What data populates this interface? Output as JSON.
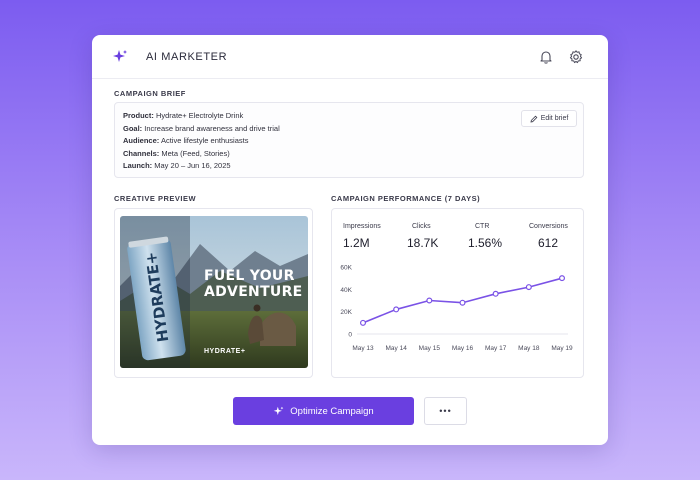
{
  "app": {
    "title": "AI MARKETER"
  },
  "header": {
    "icons": [
      "sparkle-icon",
      "bell-icon",
      "gear-icon"
    ]
  },
  "brief": {
    "section_label": "CAMPAIGN BRIEF",
    "edit_label": "Edit brief",
    "rows": [
      {
        "key": "Product:",
        "value": "Hydrate+ Electrolyte Drink"
      },
      {
        "key": "Goal:",
        "value": "Increase brand awareness and drive trial"
      },
      {
        "key": "Audience:",
        "value": "Active lifestyle enthusiasts"
      },
      {
        "key": "Channels:",
        "value": "Meta (Feed, Stories)"
      },
      {
        "key": "Launch:",
        "value": "May 20 – Jun 16, 2025"
      }
    ]
  },
  "creative": {
    "section_label": "CREATIVE PREVIEW",
    "headline_line1": "FUEL YOUR",
    "headline_line2": "ADVENTURE",
    "brand_tag": "HYDRATE+",
    "can_text": "HYDRATE+"
  },
  "performance": {
    "section_label": "CAMPAIGN PERFORMANCE (7 DAYS)",
    "metrics": [
      {
        "label": "Impressions",
        "value": "1.2M"
      },
      {
        "label": "Clicks",
        "value": "18.7K"
      },
      {
        "label": "CTR",
        "value": "1.56%"
      },
      {
        "label": "Conversions",
        "value": "612"
      }
    ]
  },
  "chart_data": {
    "type": "line",
    "categories": [
      "May 13",
      "May 14",
      "May 15",
      "May 16",
      "May 17",
      "May 18",
      "May 19"
    ],
    "series": [
      {
        "values": [
          10000,
          22000,
          30000,
          28000,
          36000,
          42000,
          50000
        ]
      }
    ],
    "yticks": [
      "60K",
      "40K",
      "20K",
      "0"
    ],
    "ylim": [
      0,
      60000
    ],
    "grid": false,
    "color": "#7a52e6"
  },
  "actions": {
    "primary_label": "Optimize Campaign",
    "more_label": "•••"
  },
  "colors": {
    "accent": "#6a3fe0",
    "line": "#7a52e6"
  }
}
